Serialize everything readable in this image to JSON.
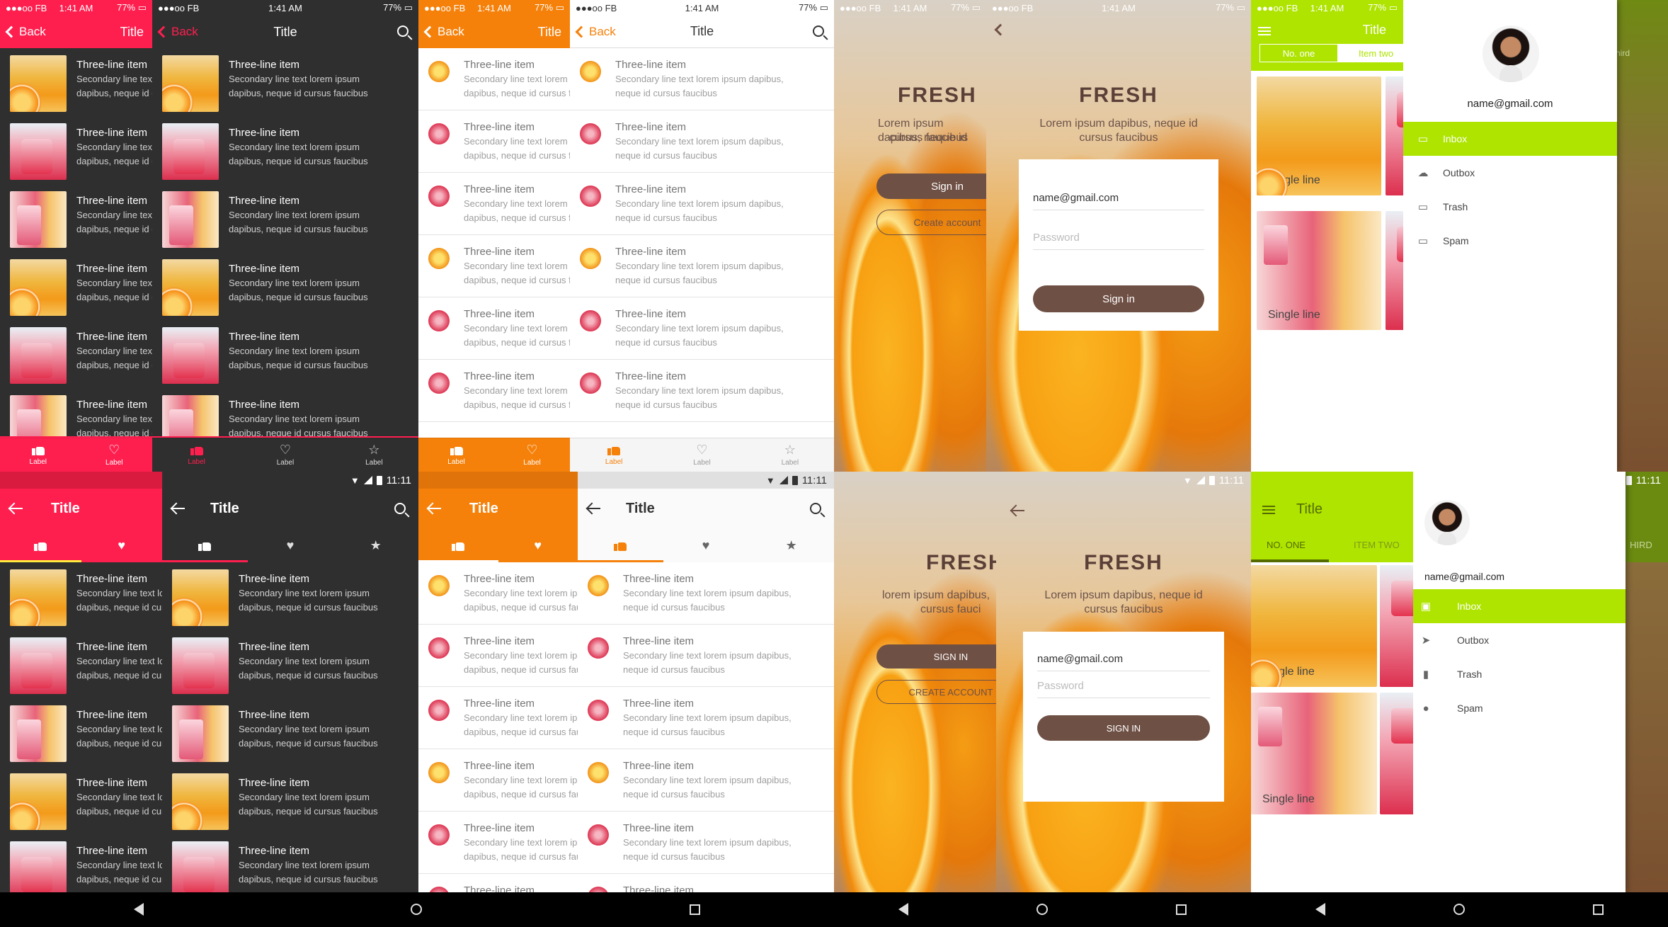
{
  "ios_status": {
    "carrier": "●●●oo FB",
    "wifi": "⌔",
    "time": "1:41 AM",
    "battery": "77% ▭"
  },
  "android_status": {
    "time": "11:11"
  },
  "nav": {
    "back": "Back",
    "title": "Title"
  },
  "android_title": "Title",
  "list_item": {
    "title": "Three-line item",
    "secondary": "Secondary line text lorem ipsum",
    "line3": "dapibus, neque id cursus faucibus",
    "secondary_full": "Secondary line text lorem ipsum dapibus,",
    "line3_short": "neque id cursus faucibus"
  },
  "tab_label": "Label",
  "fresh": {
    "title": "FRESH",
    "subtitle1": "Lorem ipsum dapibus, neque id",
    "subtitle2": "cursus faucibus",
    "ios_sign_in": "Sign in",
    "ios_create": "Create account",
    "and_sign_in": "SIGN IN",
    "and_create": "CREATE ACCOUNT",
    "sub_left1": "lorem ipsum dapibus,",
    "sub_left2": "cursus fauci"
  },
  "login": {
    "email": "name@gmail.com",
    "password_placeholder": "Password",
    "ios_button": "Sign in",
    "and_button": "SIGN IN"
  },
  "grid": {
    "caption": "Single line",
    "ios_tabs": [
      "No. one",
      "Item two"
    ],
    "and_tabs": [
      "NO. ONE",
      "ITEM TWO"
    ],
    "third_tab": "HIRD",
    "third_tab_ios": "hird"
  },
  "drawer": {
    "email": "name@gmail.com",
    "items": [
      "Inbox",
      "Outbox",
      "Trash",
      "Spam"
    ]
  },
  "colors": {
    "red": "#ff1f4f",
    "orange": "#f5810b",
    "green": "#aee400",
    "dark": "#2f2f2f",
    "brown": "#6f5045"
  }
}
